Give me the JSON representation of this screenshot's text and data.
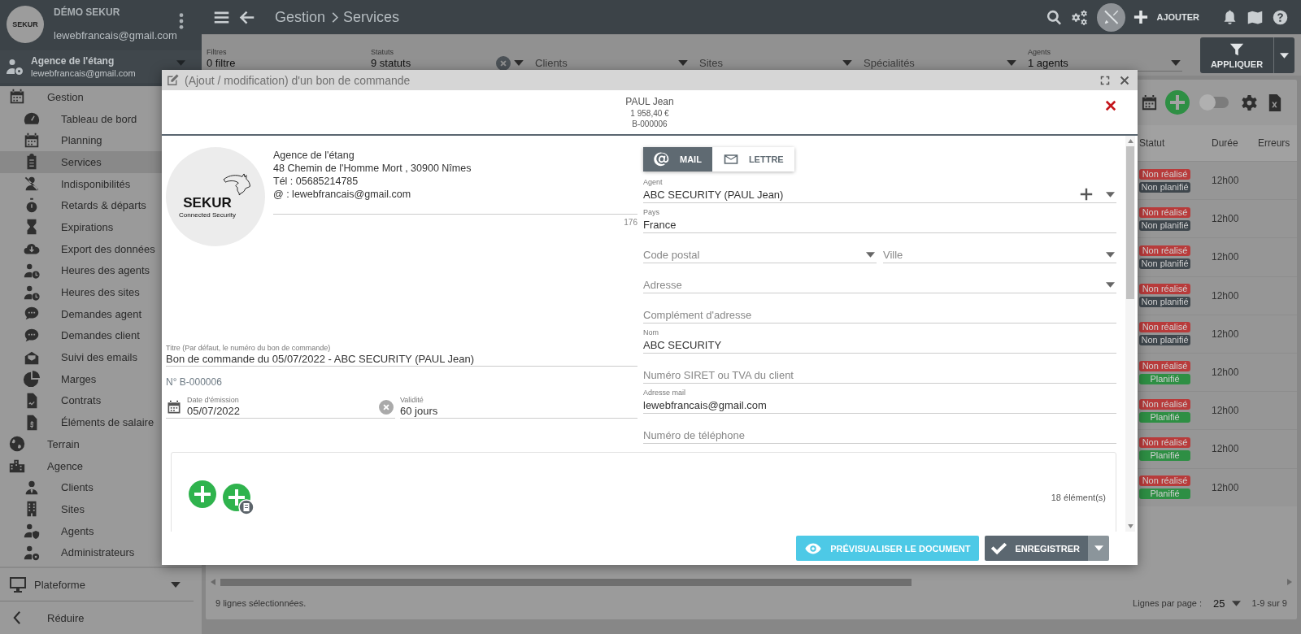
{
  "account": {
    "name": "DÉMO SEKUR",
    "email": "lewebfrancais@gmail.com",
    "logo": "SEKUR"
  },
  "agency": {
    "name": "Agence de l'étang",
    "email": "lewebfrancais@gmail.com"
  },
  "sidebar": {
    "items": [
      {
        "label": "Gestion",
        "selected": false,
        "children": [
          {
            "label": "Tableau de bord",
            "selected": false
          },
          {
            "label": "Planning",
            "selected": false
          },
          {
            "label": "Services",
            "selected": true
          },
          {
            "label": "Indisponibilités",
            "selected": false
          },
          {
            "label": "Retards & départs",
            "selected": false
          },
          {
            "label": "Expirations",
            "selected": false
          },
          {
            "label": "Export des données",
            "selected": false
          },
          {
            "label": "Heures des agents",
            "selected": false
          },
          {
            "label": "Heures des sites",
            "selected": false
          },
          {
            "label": "Demandes agent",
            "selected": false
          },
          {
            "label": "Demandes client",
            "selected": false
          },
          {
            "label": "Suivi des emails",
            "selected": false
          },
          {
            "label": "Marges",
            "selected": false
          },
          {
            "label": "Contrats",
            "selected": false
          },
          {
            "label": "Éléments de salaire",
            "selected": false
          }
        ]
      },
      {
        "label": "Terrain",
        "selected": false
      },
      {
        "label": "Agence",
        "selected": false,
        "children": [
          {
            "label": "Clients",
            "selected": false
          },
          {
            "label": "Sites",
            "selected": false
          },
          {
            "label": "Agents",
            "selected": false
          },
          {
            "label": "Administrateurs",
            "selected": false
          }
        ]
      }
    ],
    "platform": "Plateforme",
    "collapse": "Réduire"
  },
  "breadcrumb": [
    "Gestion",
    "Services"
  ],
  "add_button": "AJOUTER",
  "filters": [
    {
      "label": "Filtres",
      "value": "0 filtre",
      "dropdown": false,
      "clearable": false
    },
    {
      "label": "Statuts",
      "value": "9 statuts",
      "dropdown": true,
      "clearable": true
    },
    {
      "placeholder": "Clients",
      "dropdown": true,
      "clearable": false
    },
    {
      "placeholder": "Sites",
      "dropdown": true,
      "clearable": false
    },
    {
      "placeholder": "Spécialités",
      "dropdown": true,
      "clearable": false
    },
    {
      "label": "Agents",
      "value": "1 agents",
      "dropdown": true,
      "clearable": false
    }
  ],
  "apply_button": "APPLIQUER",
  "table": {
    "view_toggle": {
      "on": false
    },
    "columns": [
      "Statut",
      "Durée",
      "Erreurs"
    ],
    "rows": [
      {
        "tags": [
          {
            "text": "Non réalisé",
            "color": "#b83b3b"
          },
          {
            "text": "Non planifié",
            "color": "#3f474d"
          }
        ],
        "duration": "12h00"
      },
      {
        "tags": [
          {
            "text": "Non réalisé",
            "color": "#b83b3b"
          },
          {
            "text": "Non planifié",
            "color": "#3f474d"
          }
        ],
        "duration": "12h00"
      },
      {
        "tags": [
          {
            "text": "Non réalisé",
            "color": "#b83b3b"
          },
          {
            "text": "Non planifié",
            "color": "#3f474d"
          }
        ],
        "duration": "12h00"
      },
      {
        "tags": [
          {
            "text": "Non réalisé",
            "color": "#b83b3b"
          },
          {
            "text": "Non planifié",
            "color": "#3f474d"
          }
        ],
        "duration": "12h00"
      },
      {
        "tags": [
          {
            "text": "Non réalisé",
            "color": "#b83b3b"
          },
          {
            "text": "Non planifié",
            "color": "#3f474d"
          }
        ],
        "duration": "12h00"
      },
      {
        "tags": [
          {
            "text": "Non réalisé",
            "color": "#b83b3b"
          },
          {
            "text": "Planifié",
            "color": "#2e8f44"
          }
        ],
        "duration": "12h00"
      },
      {
        "tags": [
          {
            "text": "Non réalisé",
            "color": "#b83b3b"
          },
          {
            "text": "Planifié",
            "color": "#2e8f44"
          }
        ],
        "duration": "12h00"
      },
      {
        "tags": [
          {
            "text": "Non réalisé",
            "color": "#b83b3b"
          },
          {
            "text": "Planifié",
            "color": "#2e8f44"
          }
        ],
        "duration": "12h00"
      },
      {
        "tags": [
          {
            "text": "Non réalisé",
            "color": "#b83b3b"
          },
          {
            "text": "Planifié",
            "color": "#2e8f44"
          }
        ],
        "duration": "12h00"
      }
    ],
    "selection": "9 lignes sélectionnées.",
    "rows_per_page": {
      "label": "Lignes par page :",
      "value": "25"
    },
    "range": "1-9 sur 9"
  },
  "modal": {
    "title": "(Ajout / modification) d'un bon de commande",
    "summary": [
      "PAUL Jean",
      "1 958,40 €",
      "B-000006"
    ],
    "logo": {
      "name": "SEKUR",
      "tagline": "Connected Security"
    },
    "sender": {
      "lines": [
        "Agence de l'étang",
        "48 Chemin de l'Homme Mort , 30900 Nîmes",
        "Tél : 05685214785",
        "@ : lewebfrancais@gmail.com"
      ],
      "counter": "176"
    },
    "title_field": {
      "label": "Titre (Par défaut, le numéro du bon de commande)",
      "value": "Bon de commande du 05/07/2022 - ABC SECURITY (PAUL Jean)"
    },
    "number": "N° B-000006",
    "issue_date": {
      "label": "Date d'émission",
      "value": "05/07/2022"
    },
    "validity": {
      "label": "Validité",
      "value": "60 jours"
    },
    "send_modes": [
      {
        "label": "MAIL",
        "selected": true
      },
      {
        "label": "LETTRE",
        "selected": false
      }
    ],
    "recipient_rows": [
      {
        "fields": [
          {
            "label": "Agent",
            "value": "ABC SECURITY (PAUL Jean)",
            "dropdown": true,
            "add": true
          }
        ]
      },
      {
        "fields": [
          {
            "label": "Pays",
            "value": "France",
            "dropdown": false,
            "add": false
          }
        ]
      },
      {
        "fields": [
          {
            "placeholder": "Code postal",
            "dropdown": true,
            "add": false
          },
          {
            "placeholder": "Ville",
            "dropdown": true,
            "add": false
          }
        ]
      },
      {
        "fields": [
          {
            "placeholder": "Adresse",
            "dropdown": true,
            "add": false
          }
        ]
      },
      {
        "fields": [
          {
            "placeholder": "Complément d'adresse",
            "dropdown": false,
            "add": false
          }
        ]
      },
      {
        "fields": [
          {
            "label": "Nom",
            "value": "ABC SECURITY",
            "dropdown": false,
            "add": false
          }
        ]
      },
      {
        "fields": [
          {
            "placeholder": "Numéro SIRET ou TVA du client",
            "dropdown": false,
            "add": false
          }
        ]
      },
      {
        "fields": [
          {
            "label": "Adresse mail",
            "value": "lewebfrancais@gmail.com",
            "dropdown": false,
            "add": false
          }
        ]
      },
      {
        "fields": [
          {
            "placeholder": "Numéro de téléphone",
            "dropdown": false,
            "add": false
          }
        ]
      }
    ],
    "items_count": "18 élément(s)",
    "buttons": [
      {
        "label": "PRÉVISUALISER LE DOCUMENT",
        "kind": "preview"
      },
      {
        "label": "ENREGISTRER",
        "kind": "save"
      }
    ]
  }
}
